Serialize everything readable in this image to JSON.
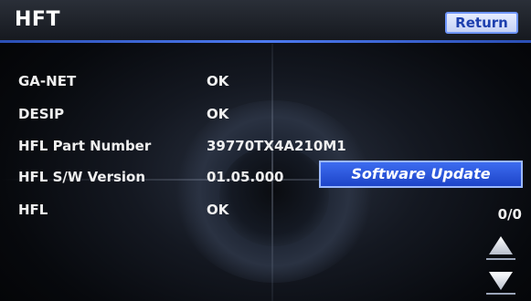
{
  "header": {
    "title": "HFT",
    "return_label": "Return"
  },
  "rows": [
    {
      "label": "GA-NET",
      "value": "OK"
    },
    {
      "label": "DESIP",
      "value": "OK"
    },
    {
      "label": "HFL Part Number",
      "value": "39770TX4A210M1"
    },
    {
      "label": "HFL S/W Version",
      "value": "01.05.000"
    },
    {
      "label": "HFL",
      "value": "OK"
    }
  ],
  "software_update_label": "Software Update",
  "page_count": "0/0",
  "icons": {
    "scroll_up": "arrow-up-icon",
    "scroll_down": "arrow-down-icon"
  },
  "colors": {
    "accent_blue": "#2b4fb5",
    "button_blue": "#1d44c8",
    "text": "#f0f0f0"
  }
}
